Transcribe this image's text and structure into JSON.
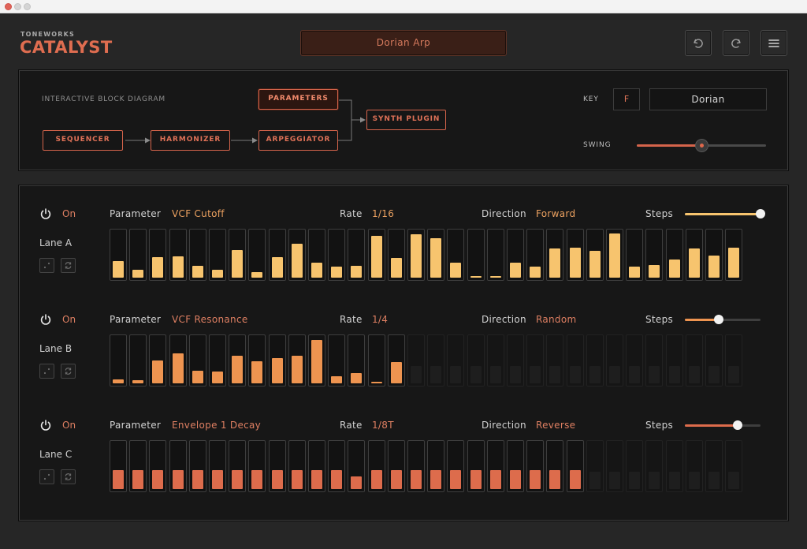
{
  "brand": {
    "company": "TONEWORKS",
    "product": "CATALYST"
  },
  "preset": {
    "name": "Dorian Arp"
  },
  "toolbar": {
    "undo_icon": "undo-icon",
    "redo_icon": "redo-icon",
    "menu_icon": "hamburger-menu-icon"
  },
  "block_diagram": {
    "title": "INTERACTIVE BLOCK DIAGRAM",
    "blocks": {
      "sequencer": "SEQUENCER",
      "harmonizer": "HARMONIZER",
      "arpeggiator": "ARPEGGIATOR",
      "parameters": "PARAMETERS",
      "synth": "SYNTH PLUGIN"
    },
    "active_block": "parameters"
  },
  "global": {
    "key_label": "KEY",
    "key_value": "F",
    "scale_value": "Dorian",
    "swing_label": "SWING",
    "swing_value": 0.5
  },
  "lane_labels": {
    "parameter": "Parameter",
    "rate": "Rate",
    "direction": "Direction",
    "steps": "Steps"
  },
  "lanes": [
    {
      "name": "Lane A",
      "power_state": "On",
      "parameter": "VCF Cutoff",
      "rate": "1/16",
      "direction": "Forward",
      "steps_fraction": 1.0,
      "active_steps": 32,
      "color": "#f7c46e",
      "values": [
        0.36,
        0.18,
        0.44,
        0.46,
        0.26,
        0.17,
        0.6,
        0.12,
        0.44,
        0.75,
        0.32,
        0.24,
        0.26,
        0.92,
        0.43,
        0.95,
        0.86,
        0.33,
        0.03,
        0.03,
        0.33,
        0.24,
        0.63,
        0.65,
        0.58,
        0.97,
        0.25,
        0.27,
        0.39,
        0.63,
        0.49,
        0.65
      ]
    },
    {
      "name": "Lane B",
      "power_state": "On",
      "parameter": "VCF Resonance",
      "rate": "1/4",
      "direction": "Random",
      "steps_fraction": 0.45,
      "active_steps": 15,
      "color": "#ee9450",
      "values": [
        0.08,
        0.07,
        0.5,
        0.66,
        0.28,
        0.26,
        0.6,
        0.49,
        0.56,
        0.6,
        0.95,
        0.15,
        0.22,
        0.04,
        0.46,
        0.0,
        0.0,
        0.0,
        0.0,
        0.0,
        0.0,
        0.0,
        0.0,
        0.0,
        0.0,
        0.0,
        0.0,
        0.0,
        0.0,
        0.0,
        0.0,
        0.0
      ]
    },
    {
      "name": "Lane C",
      "power_state": "On",
      "parameter": "Envelope 1 Decay",
      "rate": "1/8T",
      "direction": "Reverse",
      "steps_fraction": 0.7,
      "active_steps": 24,
      "color": "#dd6c4c",
      "values": [
        0.42,
        0.42,
        0.42,
        0.42,
        0.42,
        0.42,
        0.42,
        0.42,
        0.42,
        0.42,
        0.42,
        0.42,
        0.28,
        0.42,
        0.42,
        0.42,
        0.42,
        0.42,
        0.42,
        0.42,
        0.42,
        0.42,
        0.42,
        0.42,
        0.0,
        0.0,
        0.0,
        0.0,
        0.0,
        0.0,
        0.0,
        0.0
      ]
    }
  ]
}
